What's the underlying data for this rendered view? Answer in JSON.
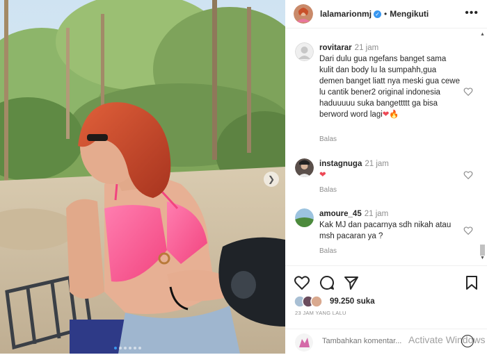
{
  "post": {
    "username": "lalamarionmj",
    "separator": "•",
    "follow_label": "Mengikuti",
    "more_label": "•••",
    "photo_alt": "Wanita berambut merah dengan bikini pink di atas ATV"
  },
  "comments": [
    {
      "user": "rovitarar",
      "time": "21 jam",
      "text": "Dari dulu gua ngefans banget sama kulit dan body lu la sumpahh,gua demen banget liatt nya meski gua cewe lu cantik bener2 original indonesia haduuuuu suka bangettttt ga bisa berword word lagi",
      "emojis": "❤🔥",
      "reply_label": "Balas"
    },
    {
      "user": "instagnuga",
      "time": "21 jam",
      "text": "",
      "emojis": "❤",
      "reply_label": "Balas"
    },
    {
      "user": "amoure_45",
      "time": "21 jam",
      "text": "Kak MJ dan pacarnya sdh nikah atau msh pacaran ya ?",
      "emojis": "",
      "reply_label": "Balas"
    }
  ],
  "actions": {
    "likes_count": "99.250",
    "likes_label": "suka",
    "time_ago": "23 JAM YANG LALU"
  },
  "add_comment": {
    "placeholder": "Tambahkan komentar...",
    "watermark": "Activate Windows"
  },
  "colors": {
    "verified": "#3897f0",
    "heart_red": "#ed4956",
    "text": "#262626",
    "muted": "#8e8e8e"
  }
}
